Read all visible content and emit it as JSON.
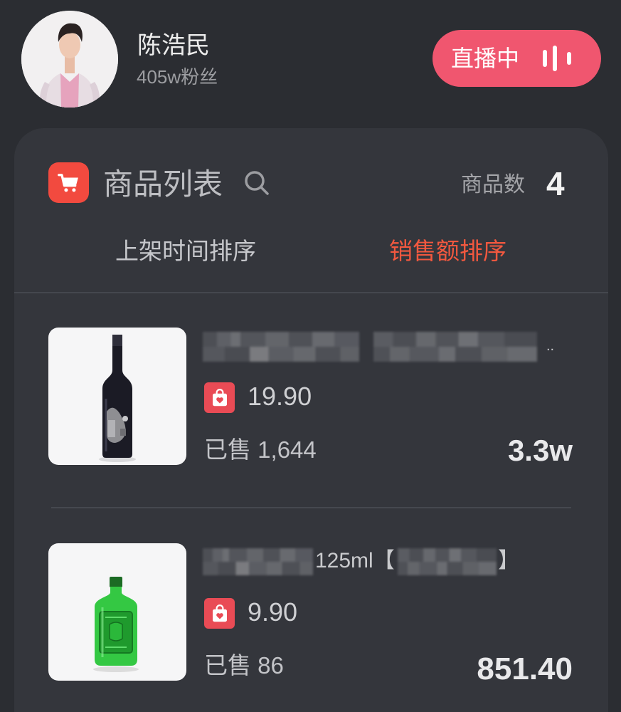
{
  "colors": {
    "background": "#2b2d32",
    "panel": "#34363c",
    "live_button": "#f0566f",
    "cart_icon_bg": "#f24a3f",
    "active_tab": "#f2583f",
    "badge_bg": "#e94b55"
  },
  "profile": {
    "name": "陈浩民",
    "fans": "405w粉丝",
    "avatar": "avatar-photo"
  },
  "live_button": {
    "label": "直播中",
    "icon": "live-bars-icon"
  },
  "product_panel": {
    "icon": "cart-icon",
    "title": "商品列表",
    "search_icon": "search-icon",
    "count_label": "商品数",
    "count_value": "4"
  },
  "tabs": [
    {
      "label": "上架时间排序",
      "active": false
    },
    {
      "label": "销售额排序",
      "active": true
    }
  ],
  "products": [
    {
      "image": "red-wine-bottle-image",
      "title_tail": "..",
      "price_icon": "shopping-bag-heart-icon",
      "price": "19.90",
      "sold": "已售 1,644",
      "sales": "3.3w"
    },
    {
      "image": "green-liquor-bottle-image",
      "title_fragment": "125ml【",
      "title_tail": "】",
      "price_icon": "shopping-bag-heart-icon",
      "price": "9.90",
      "sold": "已售 86",
      "sales": "851.40"
    }
  ]
}
